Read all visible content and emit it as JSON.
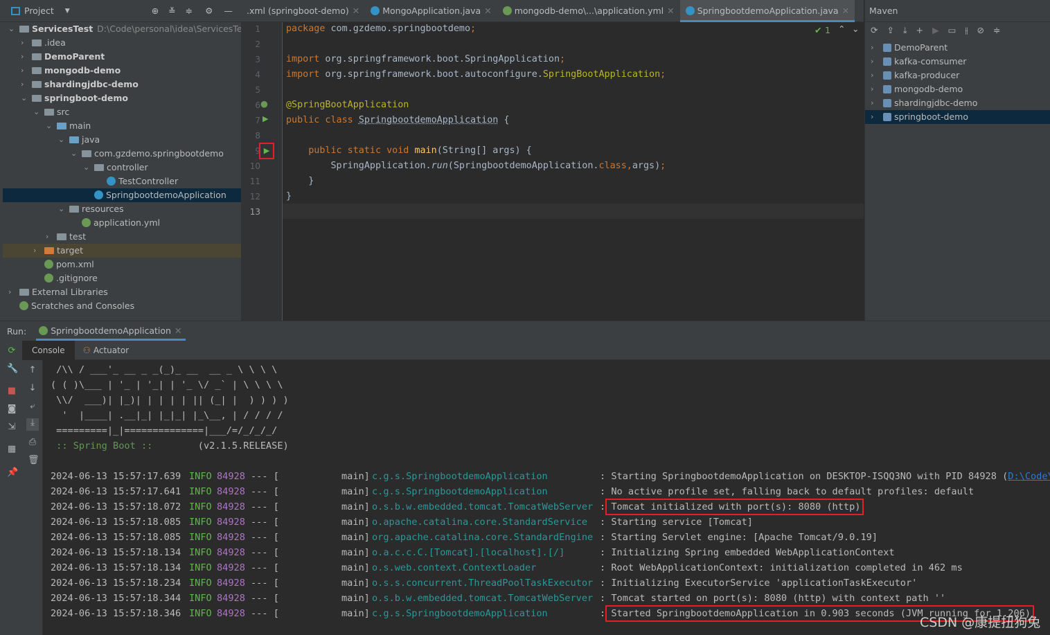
{
  "project": {
    "title": "Project",
    "tree": [
      {
        "label": "ServicesTest",
        "path": "D:\\Code\\personal\\idea\\ServicesTest",
        "depth": 0,
        "open": true,
        "bold": true
      },
      {
        "label": ".idea",
        "depth": 1
      },
      {
        "label": "DemoParent",
        "depth": 1,
        "bold": true
      },
      {
        "label": "mongodb-demo",
        "depth": 1,
        "bold": true
      },
      {
        "label": "shardingjdbc-demo",
        "depth": 1,
        "bold": true
      },
      {
        "label": "springboot-demo",
        "depth": 1,
        "bold": true,
        "open": true
      },
      {
        "label": "src",
        "depth": 2,
        "open": true
      },
      {
        "label": "main",
        "depth": 3,
        "open": true
      },
      {
        "label": "java",
        "depth": 4,
        "open": true
      },
      {
        "label": "com.gzdemo.springbootdemo",
        "depth": 5,
        "open": true
      },
      {
        "label": "controller",
        "depth": 6,
        "open": true
      },
      {
        "label": "TestController",
        "depth": 7,
        "leaf": true
      },
      {
        "label": "SpringbootdemoApplication",
        "depth": 6,
        "leaf": true,
        "selected": true
      },
      {
        "label": "resources",
        "depth": 4,
        "open": true
      },
      {
        "label": "application.yml",
        "depth": 5,
        "leaf": true
      },
      {
        "label": "test",
        "depth": 3
      },
      {
        "label": "target",
        "depth": 2
      },
      {
        "label": "pom.xml",
        "depth": 2,
        "leaf": true
      },
      {
        "label": ".gitignore",
        "depth": 2,
        "leaf": true
      },
      {
        "label": "External Libraries",
        "depth": 0
      },
      {
        "label": "Scratches and Consoles",
        "depth": 0,
        "leaf": true
      }
    ]
  },
  "editor": {
    "tabs": [
      {
        "label": ".xml (springboot-demo)"
      },
      {
        "label": "MongoApplication.java"
      },
      {
        "label": "mongodb-demo\\...\\application.yml"
      },
      {
        "label": "SpringbootdemoApplication.java",
        "active": true
      }
    ],
    "inspection_count": "1"
  },
  "maven": {
    "title": "Maven",
    "items": [
      "DemoParent",
      "kafka-comsumer",
      "kafka-producer",
      "mongodb-demo",
      "shardingjdbc-demo",
      "springboot-demo"
    ]
  },
  "run": {
    "label": "Run:",
    "config": "SpringbootdemoApplication",
    "tabs": [
      "Console",
      "Actuator"
    ],
    "banner": [
      " /\\\\ / ___'_ __ _ _(_)_ __  __ _ \\ \\ \\ \\",
      "( ( )\\___ | '_ | '_| | '_ \\/ _` | \\ \\ \\ \\",
      " \\\\/  ___)| |_)| | | | | || (_| |  ) ) ) )",
      "  '  |____| .__|_| |_|_| |_\\__, | / / / /",
      " =========|_|==============|___/=/_/_/_/"
    ],
    "boot_label": " :: Spring Boot :: ",
    "boot_version": "       (v2.1.5.RELEASE)",
    "logs": [
      {
        "ts": "2024-06-13 15:57:17.639",
        "level": "INFO",
        "pid": "84928",
        "thread": "--- [           main]",
        "logger": "c.g.s.SpringbootdemoApplication",
        "msg": "Starting SpringbootdemoApplication on DESKTOP-ISQQ3NO with PID 84928 (",
        "link": "D:\\Code\\pe"
      },
      {
        "ts": "2024-06-13 15:57:17.641",
        "level": "INFO",
        "pid": "84928",
        "thread": "--- [           main]",
        "logger": "c.g.s.SpringbootdemoApplication",
        "msg": "No active profile set, falling back to default profiles: default"
      },
      {
        "ts": "2024-06-13 15:57:18.072",
        "level": "INFO",
        "pid": "84928",
        "thread": "--- [           main]",
        "logger": "o.s.b.w.embedded.tomcat.TomcatWebServer",
        "msg": "Tomcat initialized with port(s): 8080 (http)",
        "highlight": true
      },
      {
        "ts": "2024-06-13 15:57:18.085",
        "level": "INFO",
        "pid": "84928",
        "thread": "--- [           main]",
        "logger": "o.apache.catalina.core.StandardService",
        "msg": "Starting service [Tomcat]"
      },
      {
        "ts": "2024-06-13 15:57:18.085",
        "level": "INFO",
        "pid": "84928",
        "thread": "--- [           main]",
        "logger": "org.apache.catalina.core.StandardEngine",
        "msg": "Starting Servlet engine: [Apache Tomcat/9.0.19]"
      },
      {
        "ts": "2024-06-13 15:57:18.134",
        "level": "INFO",
        "pid": "84928",
        "thread": "--- [           main]",
        "logger": "o.a.c.c.C.[Tomcat].[localhost].[/]",
        "msg": "Initializing Spring embedded WebApplicationContext"
      },
      {
        "ts": "2024-06-13 15:57:18.134",
        "level": "INFO",
        "pid": "84928",
        "thread": "--- [           main]",
        "logger": "o.s.web.context.ContextLoader",
        "msg": "Root WebApplicationContext: initialization completed in 462 ms"
      },
      {
        "ts": "2024-06-13 15:57:18.234",
        "level": "INFO",
        "pid": "84928",
        "thread": "--- [           main]",
        "logger": "o.s.s.concurrent.ThreadPoolTaskExecutor",
        "msg": "Initializing ExecutorService 'applicationTaskExecutor'"
      },
      {
        "ts": "2024-06-13 15:57:18.344",
        "level": "INFO",
        "pid": "84928",
        "thread": "--- [           main]",
        "logger": "o.s.b.w.embedded.tomcat.TomcatWebServer",
        "msg": "Tomcat started on port(s): 8080 (http) with context path ''"
      },
      {
        "ts": "2024-06-13 15:57:18.346",
        "level": "INFO",
        "pid": "84928",
        "thread": "--- [           main]",
        "logger": "c.g.s.SpringbootdemoApplication",
        "msg": "Started SpringbootdemoApplication in 0.903 seconds (JVM running for 1.206)",
        "highlight": true
      }
    ]
  },
  "watermark": "CSDN @康提扭狗兔",
  "colors": {
    "highlight_box": "#e3202a",
    "accent": "#4a88c7"
  }
}
